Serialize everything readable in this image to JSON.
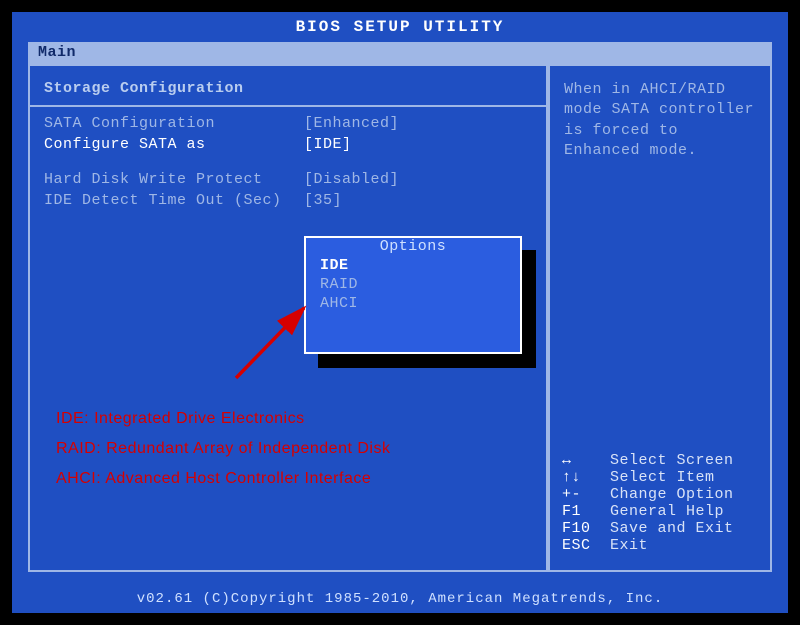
{
  "title": "BIOS SETUP UTILITY",
  "tab": "Main",
  "section_title": "Storage Configuration",
  "rows": {
    "sata_config": {
      "label": "SATA Configuration",
      "value": "[Enhanced]"
    },
    "configure_as": {
      "label": "Configure SATA as",
      "value": "[IDE]"
    },
    "hd_wp": {
      "label": "Hard Disk Write Protect",
      "value": "[Disabled]"
    },
    "ide_timeout": {
      "label": "IDE Detect Time Out (Sec)",
      "value": "[35]"
    }
  },
  "popup": {
    "title": "Options",
    "items": [
      "IDE",
      "RAID",
      "AHCI"
    ],
    "selected": "IDE"
  },
  "help_text": "When in AHCI/RAID mode SATA controller is forced to Enhanced mode.",
  "keyhelp": [
    {
      "k": "↔",
      "d": "Select Screen"
    },
    {
      "k": "↑↓",
      "d": "Select Item"
    },
    {
      "k": "+-",
      "d": "Change Option"
    },
    {
      "k": "F1",
      "d": "General Help"
    },
    {
      "k": "F10",
      "d": "Save and Exit"
    },
    {
      "k": "ESC",
      "d": "Exit"
    }
  ],
  "footer": "v02.61 (C)Copyright 1985-2010, American Megatrends, Inc.",
  "annotations": {
    "ide": "IDE:  Integrated Drive Electronics",
    "raid": "RAID: Redundant Array of Independent Disk",
    "ahci": "AHCI: Advanced Host Controller Interface"
  }
}
